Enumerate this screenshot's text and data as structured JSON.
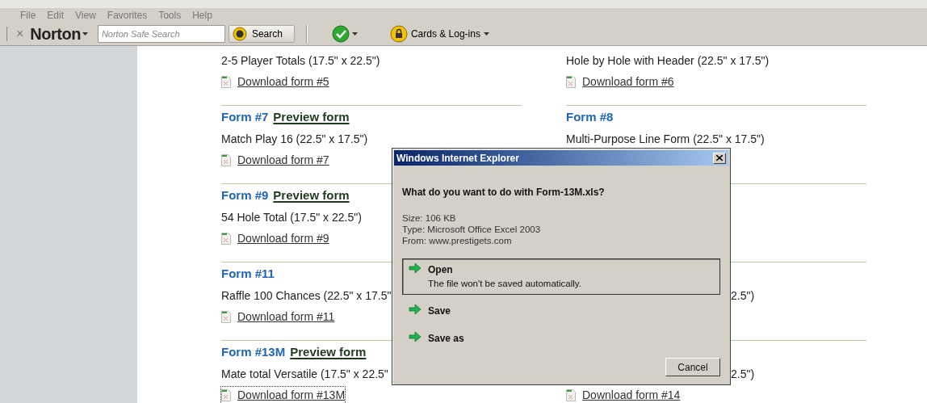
{
  "menu": [
    {
      "label": "File"
    },
    {
      "label": "Edit"
    },
    {
      "label": "View"
    },
    {
      "label": "Favorites"
    },
    {
      "label": "Tools"
    },
    {
      "label": "Help"
    }
  ],
  "toolbar": {
    "close": "×",
    "brand": "Norton",
    "search_placeholder": "Norton Safe Search",
    "search_button": "Search",
    "cards_button": "Cards & Log-ins"
  },
  "rows": [
    {
      "left": {
        "description": "2-5 Player Totals (17.5\" x 22.5\")",
        "download": "Download form #5",
        "focused": false
      },
      "right": {
        "kind": "full",
        "description": "Hole by Hole with Header (22.5\" x 17.5\")",
        "download": "Download form #6",
        "focused": false
      }
    },
    {
      "left": {
        "title": "Form #7",
        "preview": "Preview form",
        "description": "Match Play 16 (22.5\" x 17.5\")",
        "download": "Download form #7",
        "focused": false
      },
      "right": {
        "kind": "full",
        "title": "Form #8",
        "description": "Multi-Purpose Line Form (22.5\" x 17.5\")"
      }
    },
    {
      "left": {
        "title": "Form #9",
        "preview": "Preview form",
        "description": "54 Hole Total (17.5\" x 22.5\")",
        "download": "Download form #9",
        "focused": false
      }
    },
    {
      "left": {
        "title": "Form #11",
        "description": "Raffle 100 Chances (22.5\" x 17.5\"",
        "download": "Download form #11",
        "focused": false
      },
      "right": {
        "kind": "tail",
        "description": "2.5\")"
      }
    },
    {
      "left": {
        "title": "Form #13M",
        "preview": "Preview form",
        "description": "Mate total Versatile (17.5\" x 22.5\"",
        "download": "Download form #13M",
        "focused": true
      },
      "right": {
        "kind": "tail",
        "description": "2.5\")",
        "download": "Download form #14",
        "focused": false
      }
    }
  ],
  "dialog": {
    "title": "Windows Internet Explorer",
    "question": "What do you want to do with Form-13M.xls?",
    "details": [
      "Size: 106 KB",
      "Type: Microsoft Office Excel 2003",
      "From: www.prestigets.com"
    ],
    "options": [
      {
        "label": "Open",
        "note": "The file won't be saved automatically.",
        "selected": true
      },
      {
        "label": "Save",
        "selected": false
      },
      {
        "label": "Save as",
        "selected": false
      }
    ],
    "cancel": "Cancel"
  }
}
